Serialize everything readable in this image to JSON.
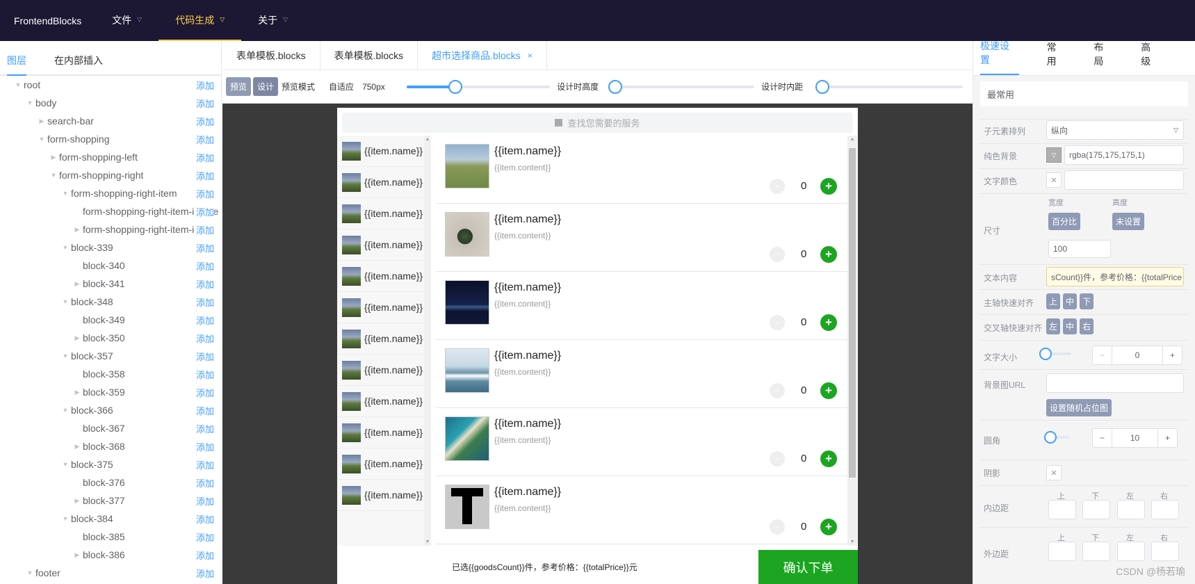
{
  "navbar": {
    "brand": "FrontendBlocks",
    "menu": [
      {
        "label": "文件",
        "active": false
      },
      {
        "label": "代码生成",
        "active": true
      },
      {
        "label": "关于",
        "active": false
      }
    ],
    "accent": "#ffd04b",
    "bg": "#1c1733"
  },
  "left_panel": {
    "tabs": [
      "图层",
      "在内部插入"
    ],
    "add_label": "添加",
    "tree": [
      {
        "label": "root",
        "depth": 0,
        "arrow": "down"
      },
      {
        "label": "body",
        "depth": 1,
        "arrow": "down"
      },
      {
        "label": "search-bar",
        "depth": 2,
        "arrow": "right"
      },
      {
        "label": "form-shopping",
        "depth": 2,
        "arrow": "down"
      },
      {
        "label": "form-shopping-left",
        "depth": 3,
        "arrow": "right"
      },
      {
        "label": "form-shopping-right",
        "depth": 3,
        "arrow": "down"
      },
      {
        "label": "form-shopping-right-item",
        "depth": 4,
        "arrow": "down"
      },
      {
        "label": "form-shopping-right-item-image",
        "depth": 5,
        "arrow": ""
      },
      {
        "label": "form-shopping-right-item-info",
        "depth": 5,
        "arrow": "right"
      },
      {
        "label": "block-339",
        "depth": 4,
        "arrow": "down"
      },
      {
        "label": "block-340",
        "depth": 5,
        "arrow": ""
      },
      {
        "label": "block-341",
        "depth": 5,
        "arrow": "right"
      },
      {
        "label": "block-348",
        "depth": 4,
        "arrow": "down"
      },
      {
        "label": "block-349",
        "depth": 5,
        "arrow": ""
      },
      {
        "label": "block-350",
        "depth": 5,
        "arrow": "right"
      },
      {
        "label": "block-357",
        "depth": 4,
        "arrow": "down"
      },
      {
        "label": "block-358",
        "depth": 5,
        "arrow": ""
      },
      {
        "label": "block-359",
        "depth": 5,
        "arrow": "right"
      },
      {
        "label": "block-366",
        "depth": 4,
        "arrow": "down"
      },
      {
        "label": "block-367",
        "depth": 5,
        "arrow": ""
      },
      {
        "label": "block-368",
        "depth": 5,
        "arrow": "right"
      },
      {
        "label": "block-375",
        "depth": 4,
        "arrow": "down"
      },
      {
        "label": "block-376",
        "depth": 5,
        "arrow": ""
      },
      {
        "label": "block-377",
        "depth": 5,
        "arrow": "right"
      },
      {
        "label": "block-384",
        "depth": 4,
        "arrow": "down"
      },
      {
        "label": "block-385",
        "depth": 5,
        "arrow": ""
      },
      {
        "label": "block-386",
        "depth": 5,
        "arrow": "right"
      },
      {
        "label": "footer",
        "depth": 1,
        "arrow": "down"
      }
    ]
  },
  "editor": {
    "file_tabs": [
      {
        "label": "表单模板.blocks",
        "active": false
      },
      {
        "label": "表单模板.blocks",
        "active": false
      },
      {
        "label": "超市选择商品.blocks",
        "active": true
      }
    ],
    "close_glyph": "×",
    "toolbar": {
      "preview_btn": "预览",
      "design_btn": "设计",
      "mode_label": "预览模式",
      "adaptive_label": "自适应",
      "width_value": "750px",
      "width_slider_fraction": 0.34,
      "design_height_label": "设计时高度",
      "design_padding_label": "设计时内距"
    }
  },
  "preview": {
    "search_placeholder": "查找您需要的服务",
    "categories": [
      "{{item.name}}",
      "{{item.name}}",
      "{{item.name}}",
      "{{item.name}}",
      "{{item.name}}",
      "{{item.name}}",
      "{{item.name}}",
      "{{item.name}}",
      "{{item.name}}",
      "{{item.name}}",
      "{{item.name}}",
      "{{item.name}}"
    ],
    "products": [
      {
        "name": "{{item.name}}",
        "content": "{{item.content}}",
        "qty": "0",
        "image": "field"
      },
      {
        "name": "{{item.name}}",
        "content": "{{item.content}}",
        "qty": "0",
        "image": "glass-sphere"
      },
      {
        "name": "{{item.name}}",
        "content": "{{item.content}}",
        "qty": "0",
        "image": "night-city"
      },
      {
        "name": "{{item.name}}",
        "content": "{{item.content}}",
        "qty": "0",
        "image": "ocean-wave"
      },
      {
        "name": "{{item.name}}",
        "content": "{{item.content}}",
        "qty": "0",
        "image": "aerial-coast"
      },
      {
        "name": "{{item.name}}",
        "content": "{{item.content}}",
        "qty": "0",
        "image": "letter-t"
      }
    ],
    "minus_glyph": "−",
    "plus_glyph": "+",
    "footer_text": "已选{{goodsCount}}件，参考价格：{{totalPrice}}元",
    "confirm_label": "确认下单",
    "green": "#1ba520"
  },
  "right_panel": {
    "tabs": [
      "极速设置",
      "常用",
      "布局",
      "高级"
    ],
    "section_title": "最常用",
    "props": {
      "child_layout_label": "子元素排列",
      "child_layout_value": "纵向",
      "solid_bg_label": "纯色背景",
      "solid_bg_value": "rgba(175,175,175,1)",
      "text_color_label": "文字颜色",
      "size_label": "尺寸",
      "width_label": "宽度",
      "height_label": "高度",
      "width_btn": "百分比",
      "height_btn": "未设置",
      "width_value": "100",
      "text_content_label": "文本内容",
      "text_content_value": "sCount}}件，参考价格：{{totalPrice",
      "main_axis_label": "主轴快速对齐",
      "main_axis_btns": [
        "上",
        "中",
        "下"
      ],
      "cross_axis_label": "交叉轴快速对齐",
      "cross_axis_btns": [
        "左",
        "中",
        "右"
      ],
      "font_size_label": "文字大小",
      "font_size_value": "0",
      "bg_url_label": "背景图URL",
      "random_img_btn": "设置随机占位图",
      "radius_label": "圆角",
      "radius_value": "10",
      "shadow_label": "阴影",
      "padding_label": "内边距",
      "margin_label": "外边距",
      "sides": [
        "上",
        "下",
        "左",
        "右"
      ]
    }
  },
  "watermark": "CSDN @杨若瑜"
}
